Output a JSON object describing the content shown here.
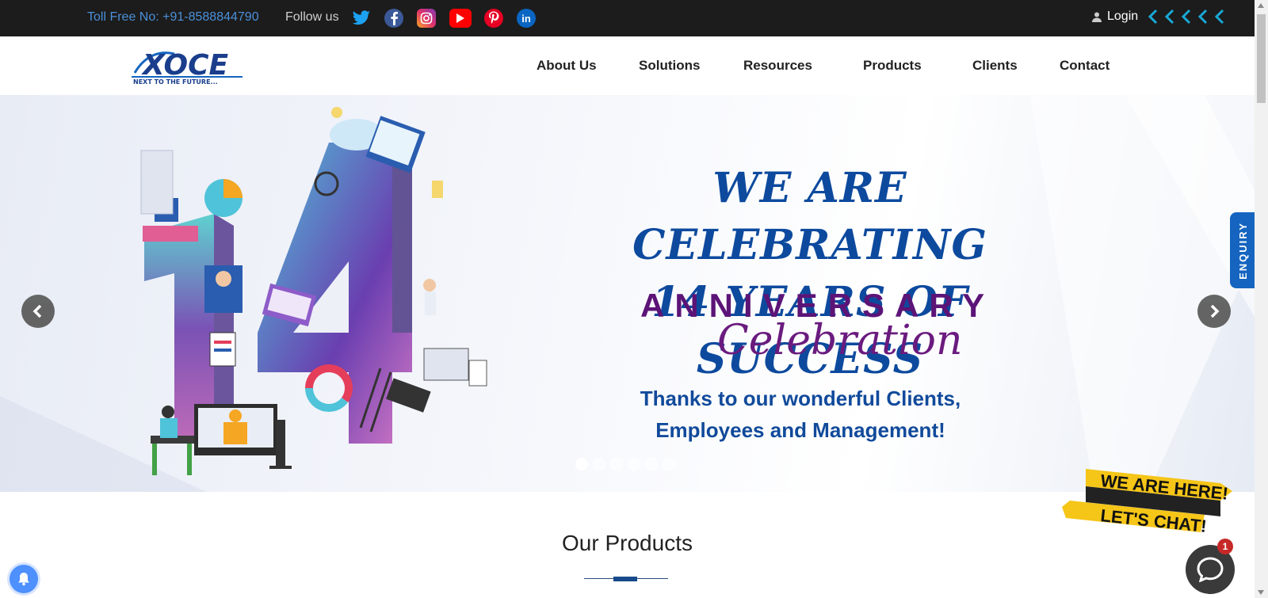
{
  "topbar": {
    "toll_free": "Toll Free No: +91-8588844790",
    "follow_label": "Follow us",
    "social_icons": [
      "twitter-icon",
      "facebook-icon",
      "instagram-icon",
      "youtube-icon",
      "pinterest-icon",
      "linkedin-icon"
    ],
    "login_label": "Login"
  },
  "navbar": {
    "logo_text": "XOCE",
    "logo_tagline": "NEXT TO THE FUTURE...",
    "items": [
      "About Us",
      "Solutions",
      "Resources",
      "Products",
      "Clients",
      "Contact"
    ]
  },
  "hero": {
    "title_line1": "WE ARE CELEBRATING",
    "title_line2": "14 YEARS OF SUCCESS",
    "anniversary": "ANNIVERSARY",
    "celebration": "Celebration",
    "thanks_line1": "Thanks to our wonderful Clients,",
    "thanks_line2": "Employees and Management!",
    "big_number": "14",
    "slides_count": 6,
    "active_slide": 1
  },
  "enquiry_label": "ENQUIRY",
  "section": {
    "title": "Our Products"
  },
  "chat": {
    "banner_line1": "WE ARE HERE!",
    "banner_line2": "LET'S CHAT!",
    "badge_count": "1"
  },
  "colors": {
    "topbar_bg": "#1c1c1c",
    "brand_blue": "#0d4a9e",
    "purple": "#5c1477",
    "chat_yellow": "#f5c518"
  }
}
